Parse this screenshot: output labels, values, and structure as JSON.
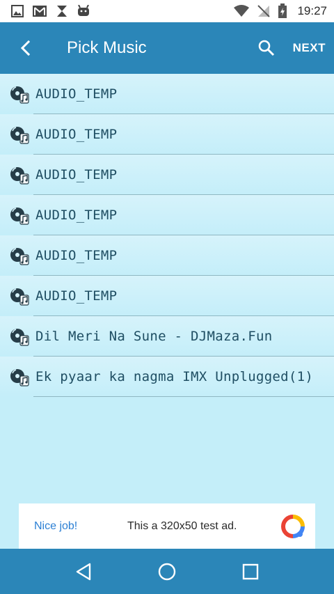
{
  "status_bar": {
    "time": "19:27",
    "left_icons": [
      "image-icon",
      "gmail-icon",
      "sync-icon",
      "android-icon"
    ],
    "right_icons": [
      "wifi-icon",
      "no-signal-icon",
      "battery-icon"
    ]
  },
  "app_bar": {
    "title": "Pick Music",
    "next_label": "NEXT",
    "back_icon": "chevron-left-icon",
    "search_icon": "search-icon"
  },
  "songs": [
    {
      "label": "AUDIO_TEMP"
    },
    {
      "label": "AUDIO_TEMP"
    },
    {
      "label": "AUDIO_TEMP"
    },
    {
      "label": "AUDIO_TEMP"
    },
    {
      "label": "AUDIO_TEMP"
    },
    {
      "label": "AUDIO_TEMP"
    },
    {
      "label": "Dil Meri Na Sune - DJMaza.Fun"
    },
    {
      "label": "Ek pyaar ka nagma IMX Unplugged(1)"
    }
  ],
  "ad": {
    "title": "Nice job!",
    "text": "This a 320x50 test ad."
  },
  "nav_bar": {
    "icons": [
      "back-triangle-icon",
      "home-circle-icon",
      "recents-square-icon"
    ]
  },
  "colors": {
    "primary": "#2b86b8",
    "list_background": "#c4eef9",
    "item_text": "#1f4e63",
    "ad_link": "#2b7fd4"
  }
}
